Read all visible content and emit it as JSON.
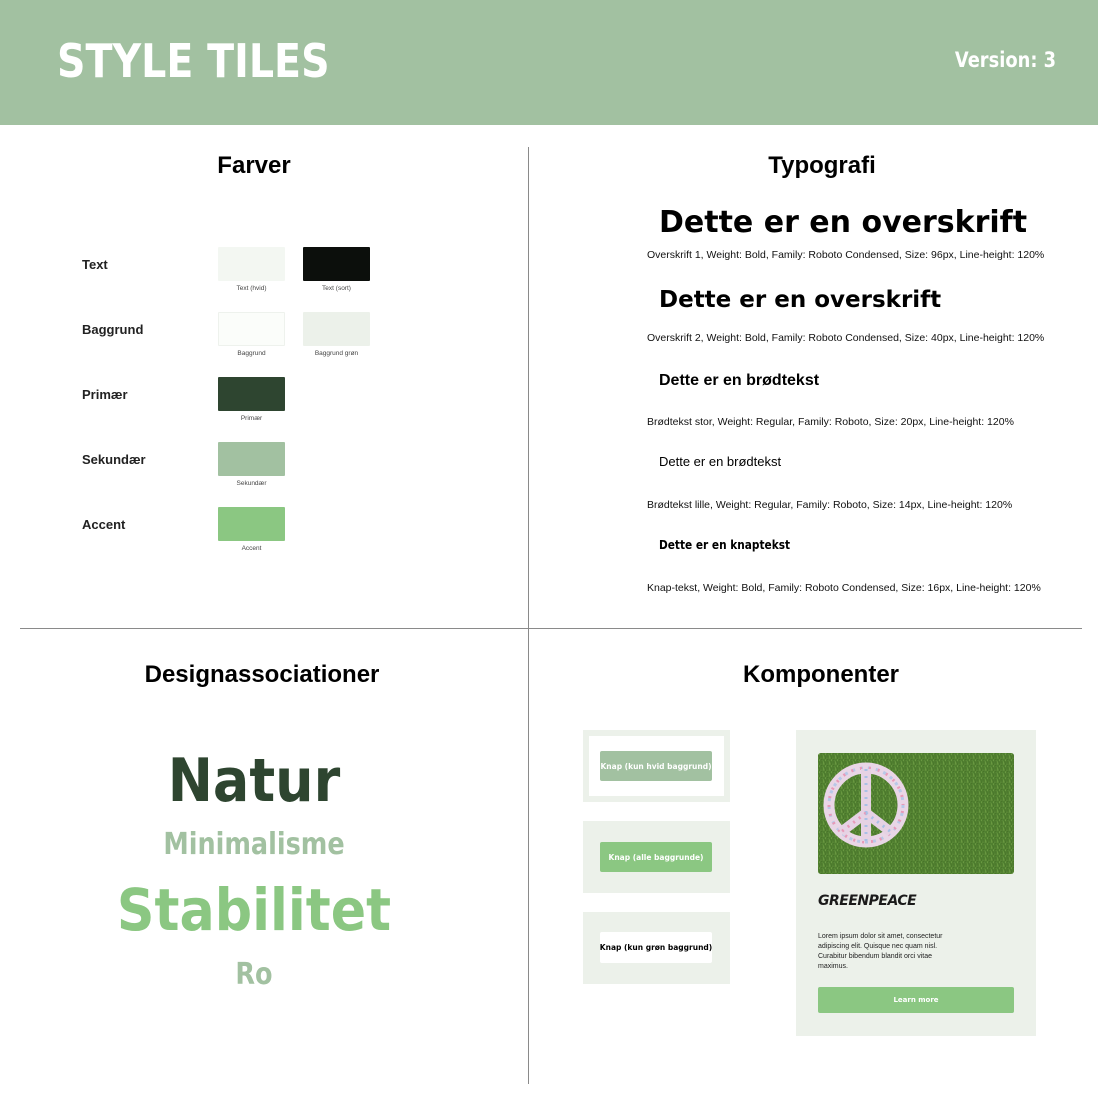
{
  "header": {
    "title": "STYLE TILES",
    "version": "Version: 3"
  },
  "colors": {
    "title": "Farver",
    "rows": [
      {
        "label": "Text",
        "swatches": [
          {
            "caption": "Text (hvid)",
            "color": "#f3f7f2"
          },
          {
            "caption": "Text (sort)",
            "color": "#0c0f0c"
          }
        ]
      },
      {
        "label": "Baggrund",
        "swatches": [
          {
            "caption": "Baggrund",
            "color": "#fbfdfa"
          },
          {
            "caption": "Baggrund grøn",
            "color": "#ecf1ea"
          }
        ]
      },
      {
        "label": "Primær",
        "swatches": [
          {
            "caption": "Primær",
            "color": "#2e4530"
          }
        ]
      },
      {
        "label": "Sekundær",
        "swatches": [
          {
            "caption": "Sekundær",
            "color": "#a2c1a1"
          }
        ]
      },
      {
        "label": "Accent",
        "swatches": [
          {
            "caption": "Accent",
            "color": "#8bc782"
          }
        ]
      }
    ]
  },
  "typography": {
    "title": "Typografi",
    "h1_sample": "Dette er en overskrift",
    "h1_desc": "Overskrift 1, Weight: Bold, Family: Roboto Condensed, Size: 96px, Line-height: 120%",
    "h2_sample": "Dette er en overskrift",
    "h2_desc": "Overskrift 2, Weight: Bold, Family: Roboto Condensed, Size: 40px, Line-height: 120%",
    "body_large_sample": "Dette er en brødtekst",
    "body_large_desc": "Brødtekst stor, Weight: Regular, Family: Roboto, Size: 20px, Line-height: 120%",
    "body_small_sample": "Dette er en brødtekst",
    "body_small_desc": "Brødtekst lille, Weight: Regular, Family: Roboto, Size: 14px, Line-height: 120%",
    "button_sample": "Dette er en knaptekst",
    "button_desc": "Knap-tekst, Weight: Bold, Family: Roboto Condensed, Size: 16px, Line-height: 120%"
  },
  "associations": {
    "title": "Designassociationer",
    "words": [
      {
        "text": "Natur",
        "color": "#2e4530"
      },
      {
        "text": "Minimalisme",
        "color": "#a2c1a1"
      },
      {
        "text": "Stabilitet",
        "color": "#8bc782"
      },
      {
        "text": "Ro",
        "color": "#a2c1a1"
      }
    ]
  },
  "components": {
    "title": "Komponenter",
    "button_white_bg": "Knap (kun hvid baggrund)",
    "button_all_bg": "Knap (alle baggrunde)",
    "button_green_bg": "Knap (kun grøn baggrund)",
    "card": {
      "logo": "GREENPEACE",
      "body": "Lorem ipsum dolor sit amet, consectetur adipiscing elit. Quisque nec quam nisl. Curabitur bibendum blandit orci vitae maximus.",
      "button": "Learn more",
      "image": "peace-sign-on-grass"
    }
  }
}
